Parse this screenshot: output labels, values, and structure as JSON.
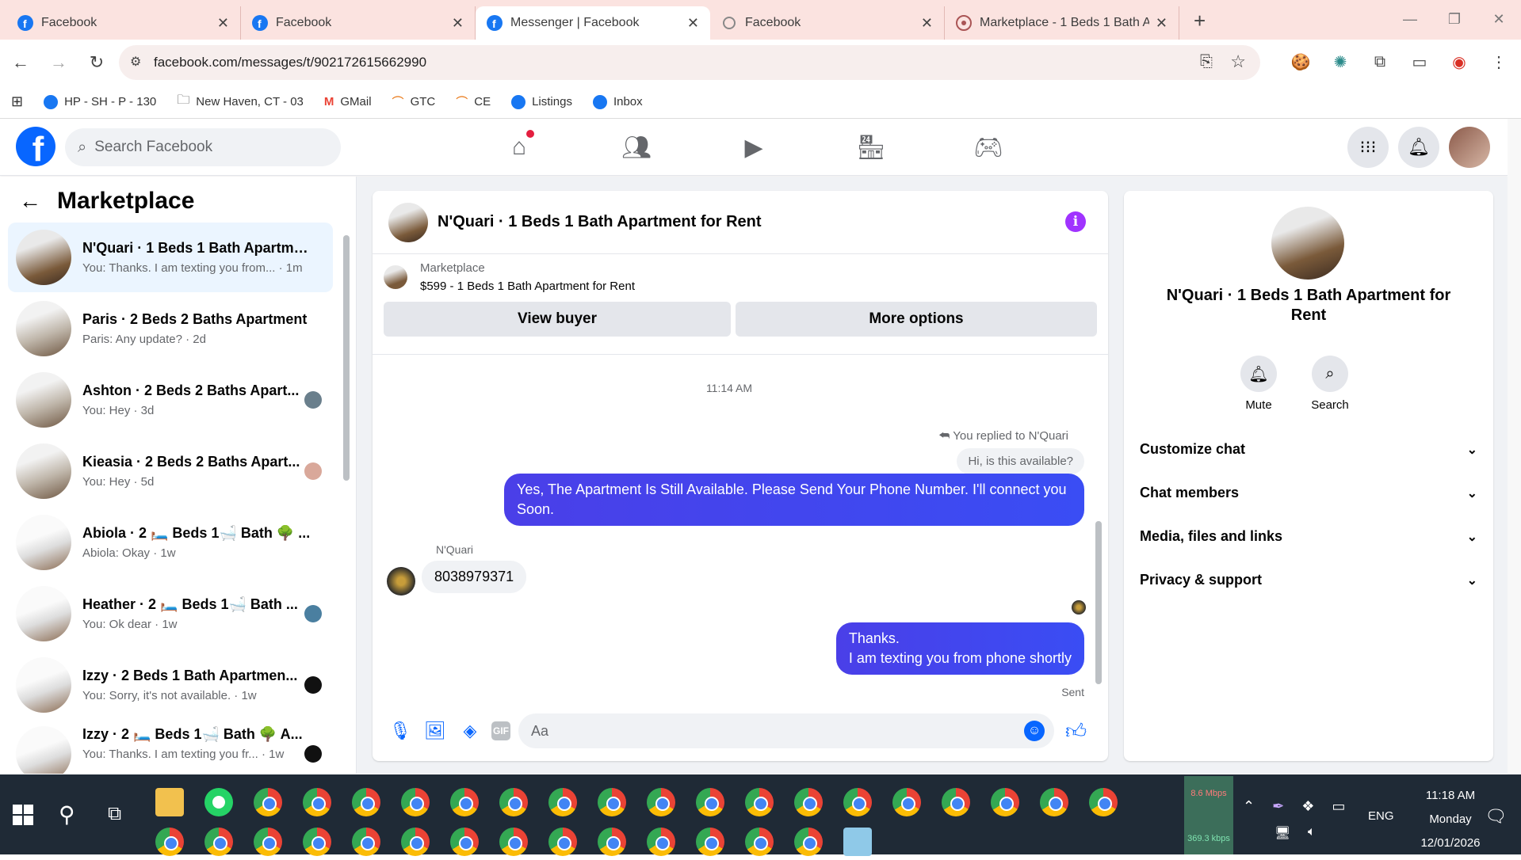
{
  "browser": {
    "tabs": [
      {
        "title": "Facebook",
        "icon": "facebook-icon",
        "active": false
      },
      {
        "title": "Facebook",
        "icon": "facebook-icon",
        "active": false
      },
      {
        "title": "Messenger | Facebook",
        "icon": "facebook-icon",
        "active": true
      },
      {
        "title": "Facebook",
        "icon": "loading-icon",
        "active": false
      },
      {
        "title": "Marketplace - 1 Beds 1 Bath Ap",
        "icon": "chrome-icon",
        "active": false
      }
    ],
    "url": "facebook.com/messages/t/902172615662990",
    "bookmarks": [
      {
        "label": "HP - SH - P - 130"
      },
      {
        "label": "New Haven, CT - 03"
      },
      {
        "label": "GMail"
      },
      {
        "label": "GTC"
      },
      {
        "label": "CE"
      },
      {
        "label": "Listings"
      },
      {
        "label": "Inbox"
      }
    ]
  },
  "fb": {
    "search_placeholder": "Search Facebook",
    "accent": "#0866ff"
  },
  "sidebar": {
    "title": "Marketplace",
    "conversations": [
      {
        "name": "N'Quari · 1 Beds 1 Bath Apartme...",
        "preview": "You: Thanks. I am texting you from... · 1m"
      },
      {
        "name": "Paris · 2 Beds 2 Baths Apartment",
        "preview": "Paris: Any update? · 2d"
      },
      {
        "name": "Ashton · 2 Beds 2 Baths Apart...",
        "preview": "You: Hey · 3d"
      },
      {
        "name": "Kieasia · 2 Beds 2 Baths Apart...",
        "preview": "You: Hey · 5d"
      },
      {
        "name": "Abiola · 2 🛏️ Beds 1🛁 Bath 🌳 ...",
        "preview": "Abiola: Okay · 1w"
      },
      {
        "name": "Heather · 2 🛏️ Beds 1🛁 Bath ...",
        "preview": "You: Ok dear · 1w"
      },
      {
        "name": "Izzy · 2 Beds 1 Bath Apartmen...",
        "preview": "You: Sorry, it's not available. · 1w"
      },
      {
        "name": "Izzy · 2 🛏️ Beds 1🛁 Bath 🌳 A...",
        "preview": "You: Thanks. I am texting you fr... · 1w"
      }
    ]
  },
  "chat": {
    "title": "N'Quari · 1 Beds 1 Bath Apartment for Rent",
    "listing_source": "Marketplace",
    "listing_title": "$599 - 1 Beds 1 Bath Apartment for Rent",
    "view_buyer": "View buyer",
    "more_options": "More options",
    "timestamp": "11:14 AM",
    "replied_label": "You replied to N'Quari",
    "quoted": "Hi, is this available?",
    "msg_out_1": "Yes, The Apartment Is Still Available. Please Send Your Phone Number. I'll connect you Soon.",
    "sender": "N'Quari",
    "msg_in_1": "8038979371",
    "msg_out_2_line1": "Thanks.",
    "msg_out_2_line2": "I am texting you from phone shortly",
    "status": "Sent",
    "composer_placeholder": "Aa"
  },
  "details": {
    "name": "N'Quari · 1 Beds 1 Bath Apartment for Rent",
    "mute": "Mute",
    "search": "Search",
    "sections": [
      "Customize chat",
      "Chat members",
      "Media, files and links",
      "Privacy & support"
    ]
  },
  "taskbar": {
    "net_down": "8.6 Mbps",
    "net_up": "369.3 kbps",
    "lang": "ENG",
    "time": "11:18 AM",
    "day": "Monday",
    "date": "12/01/2026"
  }
}
